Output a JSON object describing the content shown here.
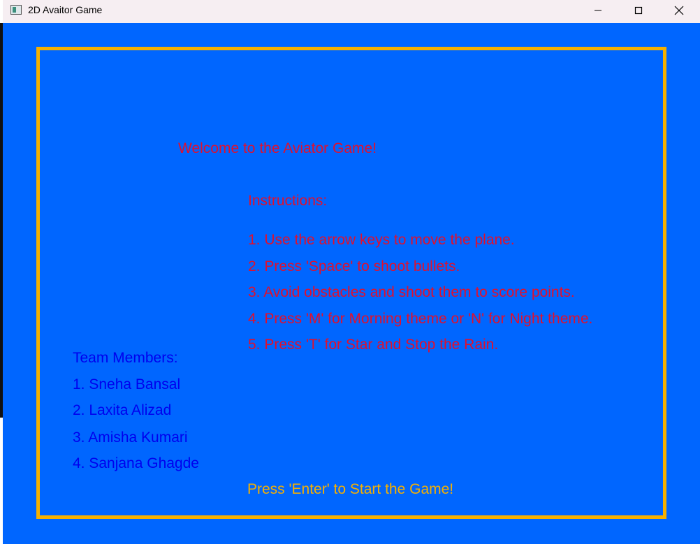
{
  "window": {
    "title": "2D Avaitor Game"
  },
  "game": {
    "welcome": "Welcome to the Aviator Game!",
    "instructions_heading": "Instructions:",
    "instructions": [
      "1. Use the arrow keys to move the plane.",
      "2. Press 'Space' to shoot bullets.",
      "3. Avoid obstacles and shoot them to score points.",
      "4. Press 'M' for Morning theme or 'N' for Night theme.",
      "5. Press 'T' for Star and Stop the Rain."
    ],
    "team_heading": "Team Members:",
    "team_members": [
      "1. Sneha Bansal",
      "2. Laxita Alizad",
      "3. Amisha Kumari",
      "4. Sanjana Ghagde"
    ],
    "start_prompt": "Press 'Enter' to Start the Game!"
  },
  "colors": {
    "background": "#0066ff",
    "frame": "#f5b000",
    "instruction_text": "#e0102e",
    "team_text": "#0000ee",
    "start_text": "#f5b000"
  },
  "icons": {
    "minimize": "minimize-icon",
    "maximize": "maximize-icon",
    "close": "close-icon"
  }
}
